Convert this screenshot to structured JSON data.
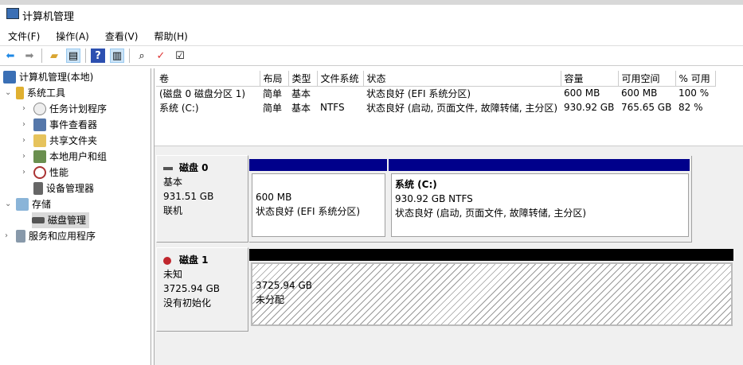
{
  "window": {
    "title": "计算机管理"
  },
  "menu": [
    "文件(F)",
    "操作(A)",
    "查看(V)",
    "帮助(H)"
  ],
  "tree": {
    "root": "计算机管理(本地)",
    "system_tools": "系统工具",
    "items": [
      "任务计划程序",
      "事件查看器",
      "共享文件夹",
      "本地用户和组",
      "性能",
      "设备管理器"
    ],
    "storage": "存储",
    "disk_mgmt": "磁盘管理",
    "services": "服务和应用程序"
  },
  "volumes": {
    "headers": [
      "卷",
      "布局",
      "类型",
      "文件系统",
      "状态",
      "容量",
      "可用空间",
      "% 可用"
    ],
    "rows": [
      [
        "(磁盘 0 磁盘分区 1)",
        "简单",
        "基本",
        "",
        "状态良好 (EFI 系统分区)",
        "600 MB",
        "600 MB",
        "100 %"
      ],
      [
        "系统 (C:)",
        "简单",
        "基本",
        "NTFS",
        "状态良好 (启动, 页面文件, 故障转储, 主分区)",
        "930.92 GB",
        "765.65 GB",
        "82 %"
      ]
    ]
  },
  "disks": [
    {
      "name": "磁盘 0",
      "type": "基本",
      "size": "931.51 GB",
      "status": "联机",
      "partitions": [
        {
          "title": "",
          "size": "600 MB",
          "status": "状态良好 (EFI 系统分区)"
        },
        {
          "title": "系统  (C:)",
          "size": "930.92 GB NTFS",
          "status": "状态良好 (启动, 页面文件, 故障转储, 主分区)"
        }
      ]
    },
    {
      "name": "磁盘 1",
      "type": "未知",
      "size": "3725.94 GB",
      "status": "没有初始化",
      "partitions": [
        {
          "size": "3725.94 GB",
          "status": "未分配"
        }
      ]
    }
  ],
  "colors": {
    "primary_bar": "#00008b",
    "unallocated_bar": "#000000"
  }
}
